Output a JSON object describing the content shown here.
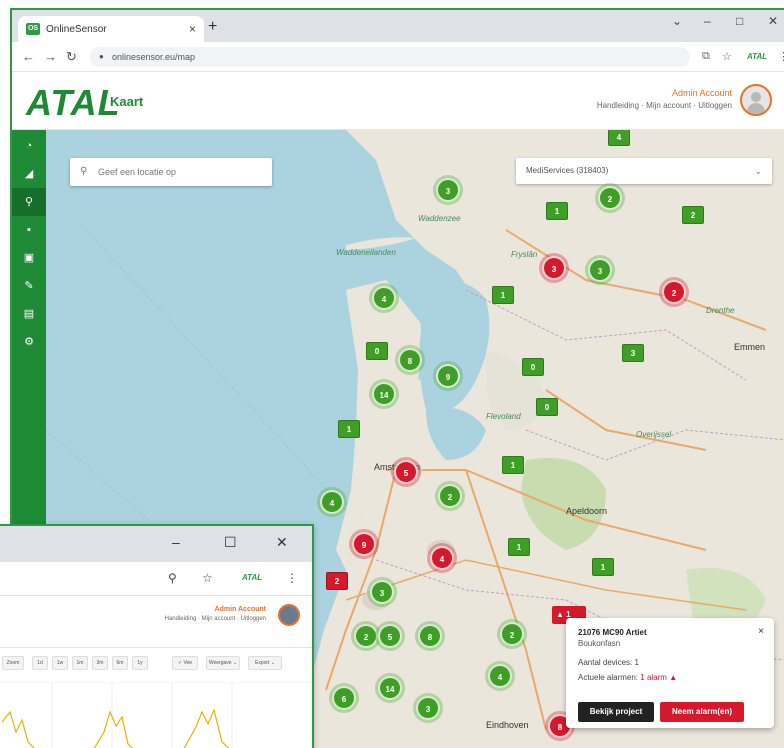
{
  "browser": {
    "tab_title": "OnlineSensor",
    "tab_favicon": "OS",
    "tab_close": "×",
    "new_tab": "+",
    "url": "onlinesensor.eu/map",
    "controls": {
      "chevron": "⌄",
      "minimize": "–",
      "maximize": "□",
      "close": "✕"
    }
  },
  "app": {
    "logo": "ATAL",
    "page_title": "Kaart",
    "user_name": "Admin Account",
    "user_links": "Handleiding · Mijn account · Uitloggen"
  },
  "sidebar": {
    "items": [
      {
        "icon": "dashboard-icon",
        "glyph": "◔"
      },
      {
        "icon": "chart-icon",
        "glyph": "◢"
      },
      {
        "icon": "map-pin-icon",
        "glyph": "⚲"
      },
      {
        "icon": "briefcase-icon",
        "glyph": "▪"
      },
      {
        "icon": "devices-icon",
        "glyph": "▣"
      },
      {
        "icon": "edit-icon",
        "glyph": "✎"
      },
      {
        "icon": "document-icon",
        "glyph": "▤"
      },
      {
        "icon": "settings-icon",
        "glyph": "⚙"
      }
    ]
  },
  "map": {
    "search_placeholder": "Geef een locatie op",
    "account_select": "MediServices (318403)",
    "labels": {
      "waddenzee": "Waddenzee",
      "friesland": "Fryslân",
      "drenthe": "Drenthe",
      "flevoland": "Flevoland",
      "overijssel": "Overijssel",
      "amsterdam": "Amsterdam",
      "waddeneilanden": "Waddeneilanden",
      "emmen": "Emmen",
      "apeldoorn": "Apeldoorn",
      "eindhoven": "Eindhoven"
    },
    "clusters": [
      {
        "label": "3",
        "color": "green"
      },
      {
        "label": "2",
        "color": "green"
      },
      {
        "label": "3",
        "color": "red"
      },
      {
        "label": "3",
        "color": "green"
      },
      {
        "label": "2",
        "color": "red"
      },
      {
        "label": "4",
        "color": "green"
      },
      {
        "label": "8",
        "color": "green"
      },
      {
        "label": "9",
        "color": "green"
      },
      {
        "label": "14",
        "color": "green"
      },
      {
        "label": "5",
        "color": "red"
      },
      {
        "label": "2",
        "color": "green"
      },
      {
        "label": "4",
        "color": "green"
      },
      {
        "label": "9",
        "color": "red"
      },
      {
        "label": "4",
        "color": "red"
      },
      {
        "label": "3",
        "color": "green"
      },
      {
        "label": "2",
        "color": "green"
      },
      {
        "label": "5",
        "color": "green"
      },
      {
        "label": "8",
        "color": "green"
      },
      {
        "label": "2",
        "color": "green"
      },
      {
        "label": "4",
        "color": "green"
      },
      {
        "label": "14",
        "color": "green"
      },
      {
        "label": "6",
        "color": "green"
      },
      {
        "label": "3",
        "color": "green"
      },
      {
        "label": "8",
        "color": "red"
      }
    ],
    "pins": [
      {
        "label": "4",
        "color": "green"
      },
      {
        "label": "1",
        "color": "green"
      },
      {
        "label": "2",
        "color": "green"
      },
      {
        "label": "1",
        "color": "green"
      },
      {
        "label": "0",
        "color": "green"
      },
      {
        "label": "3",
        "color": "green"
      },
      {
        "label": "0",
        "color": "green"
      },
      {
        "label": "1",
        "color": "green"
      },
      {
        "label": "0",
        "color": "green"
      },
      {
        "label": "1",
        "color": "green"
      },
      {
        "label": "1",
        "color": "green"
      },
      {
        "label": "2",
        "color": "red"
      },
      {
        "label": "1",
        "color": "green"
      }
    ],
    "alarm_pin": "1"
  },
  "popup": {
    "title": "21076 MC90 Artiet",
    "subtitle": "Boukonfasn",
    "devices": "Aantal devices: 1",
    "alarms_prefix": "Actuele alarmen:",
    "alarms_value": "1 alarm",
    "btn_project": "Bekijk project",
    "btn_alarm": "Neem alarm(en)",
    "close": "×"
  },
  "second_window": {
    "minimize": "–",
    "maximize": "☐",
    "close": "✕",
    "user_name": "Admin Account",
    "user_links": "Handleiding · Mijn account · Uitloggen",
    "toolbar": [
      "Zoom",
      "1d",
      "1w",
      "1m",
      "3m",
      "6m",
      "1y",
      "✓ Vee",
      "Weergave ⌄",
      "Export ⌄"
    ]
  },
  "colors": {
    "brand_green": "#1f8a36",
    "alarm_red": "#d4192c",
    "user_orange": "#e8702a"
  }
}
